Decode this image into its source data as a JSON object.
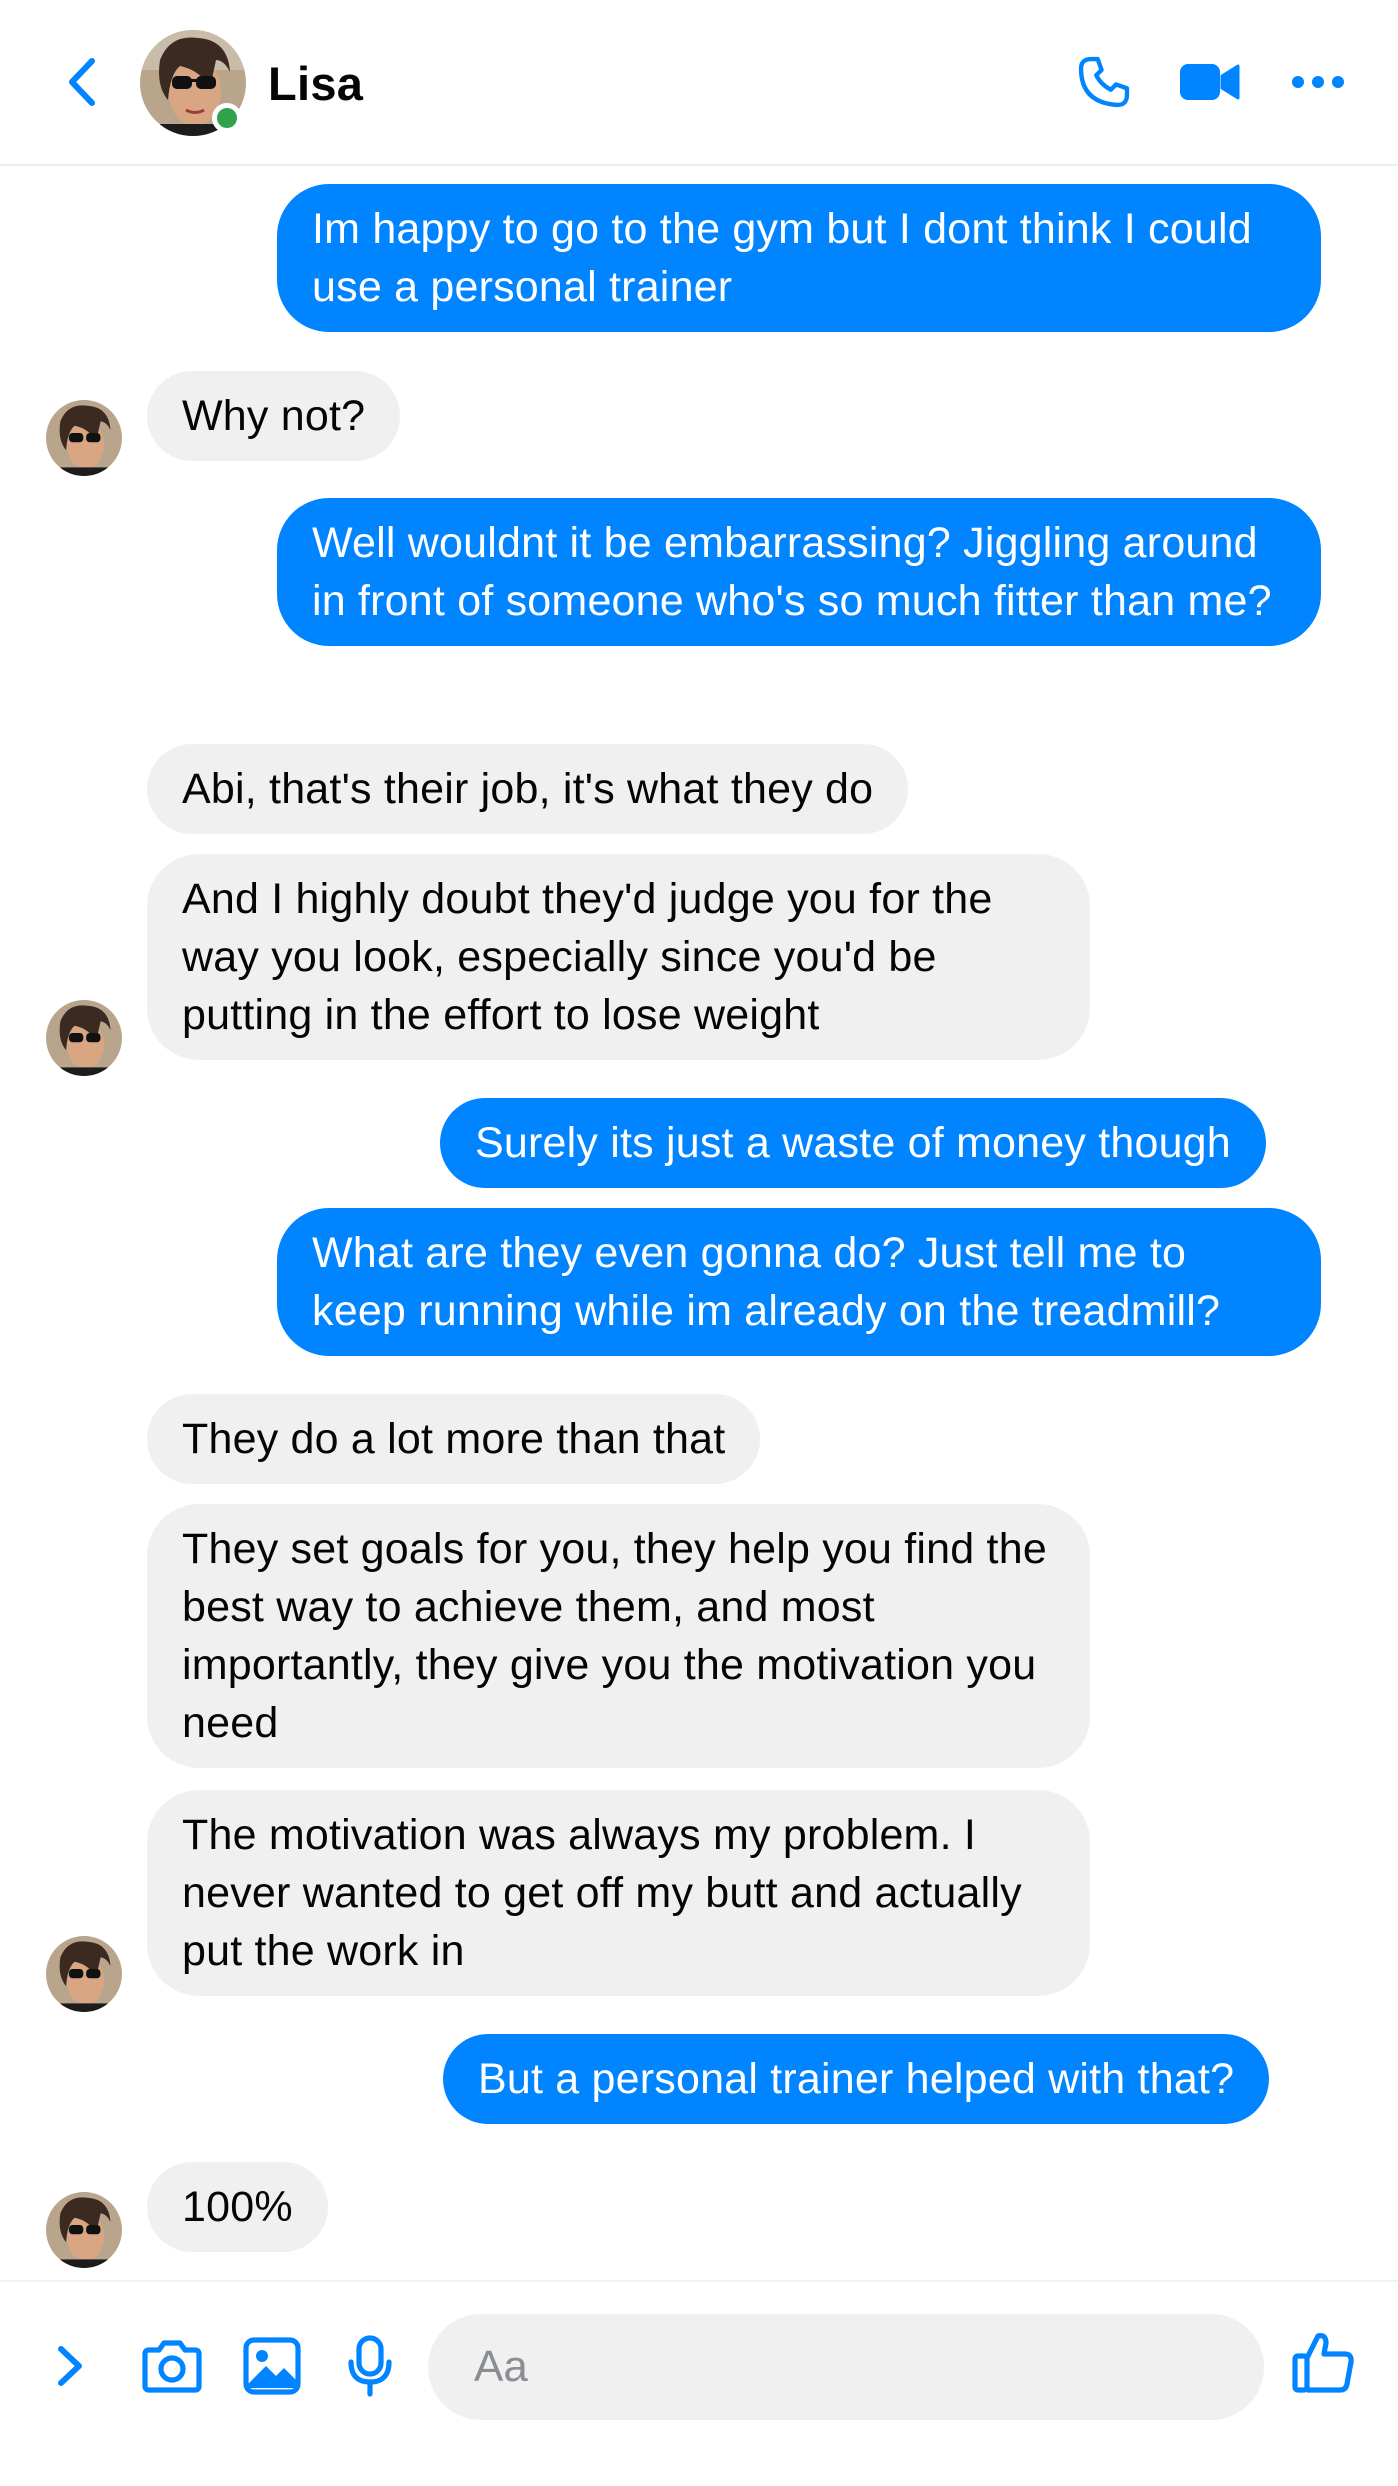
{
  "header": {
    "contact_name": "Lisa",
    "back_icon": "chevron-left-icon",
    "call_icon": "phone-icon",
    "video_icon": "video-camera-icon",
    "more_icon": "more-dots-icon",
    "presence": "online"
  },
  "messages": [
    {
      "sender": "me",
      "text": "Im happy to go to the gym but I dont think I could use a personal trainer"
    },
    {
      "sender": "Lisa",
      "text": "Why not?"
    },
    {
      "sender": "me",
      "text": "Well wouldnt it be embarrassing? Jiggling around in front of someone who's so much fitter than me?"
    },
    {
      "sender": "Lisa",
      "text": "Abi, that's their job, it's what they do"
    },
    {
      "sender": "Lisa",
      "text": "And I highly doubt they'd judge you for the way you look, especially since you'd be putting in the effort to lose weight"
    },
    {
      "sender": "me",
      "text": "Surely its just a waste of money though"
    },
    {
      "sender": "me",
      "text": "What are they even gonna do? Just tell me to keep running while im already on the treadmill?"
    },
    {
      "sender": "Lisa",
      "text": "They do a lot more than that"
    },
    {
      "sender": "Lisa",
      "text": "They set goals for you, they help you find the best way to achieve them, and most importantly, they give you the motivation you need"
    },
    {
      "sender": "Lisa",
      "text": "The motivation was always my problem. I never wanted to get off my butt and actually put the work in"
    },
    {
      "sender": "me",
      "text": "But a personal trainer helped with that?"
    },
    {
      "sender": "Lisa",
      "text": "100%"
    }
  ],
  "composer": {
    "placeholder": "Aa",
    "expand_icon": "chevron-right-icon",
    "camera_icon": "camera-icon",
    "gallery_icon": "image-icon",
    "mic_icon": "microphone-icon",
    "like_icon": "thumbs-up-icon"
  },
  "colors": {
    "accent": "#0084ff",
    "outgoing_bubble": "#0084ff",
    "incoming_bubble": "#f0f0f0",
    "presence": "#31a24c"
  }
}
